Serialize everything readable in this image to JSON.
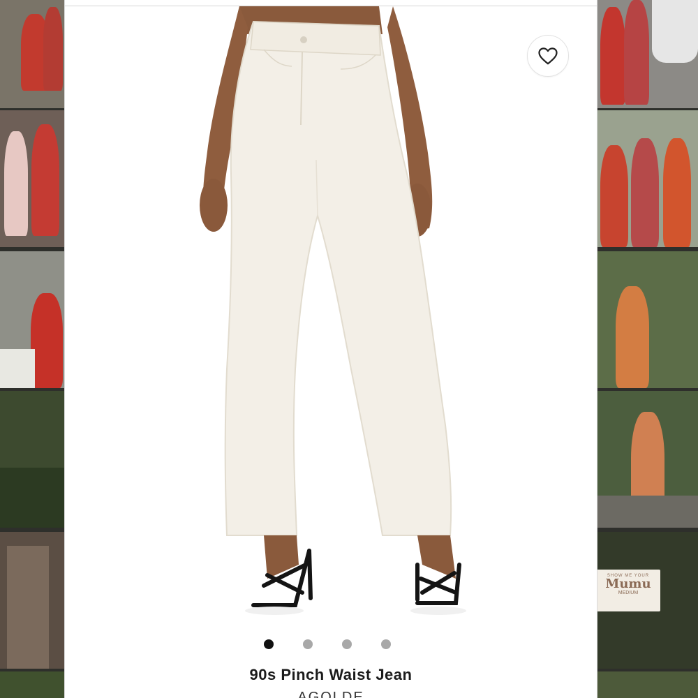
{
  "product": {
    "title": "90s Pinch Waist Jean",
    "brand": "AGOLDE",
    "image_alt": "White straight-leg jeans worn with black strappy heels",
    "image_count": 4,
    "active_image": 1
  },
  "actions": {
    "favorite_icon": "heart-icon"
  },
  "background_tiles": {
    "left_label": "",
    "right_tag_text_1": "Mumu",
    "right_tag_text_2": "MEDIUM",
    "right_tag_text_small": "SHOW ME YOUR"
  },
  "colors": {
    "card": "#ffffff",
    "denim": "#f3efe7",
    "dot_active": "#111111",
    "dot_inactive": "#a8a8a8"
  }
}
